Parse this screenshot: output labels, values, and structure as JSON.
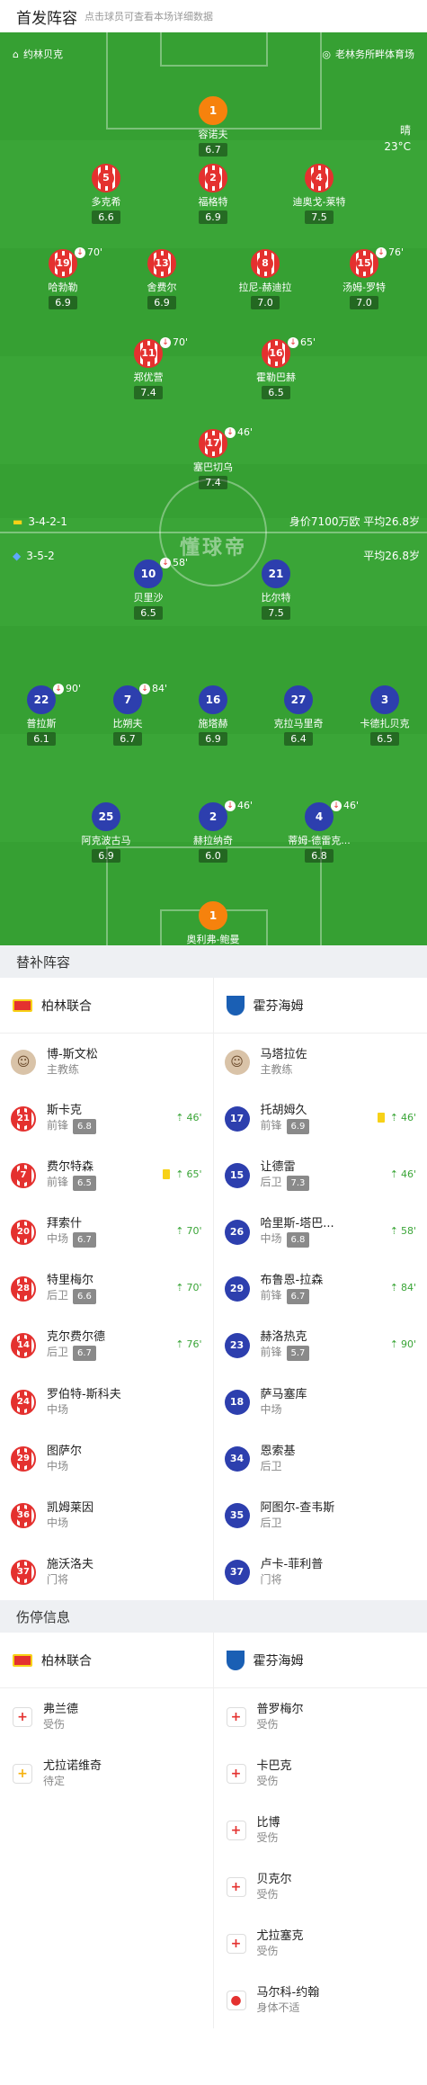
{
  "header": {
    "title": "首发阵容",
    "subtitle": "点击球员可查看本场详细数据"
  },
  "pitch": {
    "home_team": "约林贝克",
    "venue": "老林务所畔体育场",
    "weather": "晴",
    "temperature": "23°C",
    "watermark": "懂球帝",
    "home_formation": "3-4-2-1",
    "home_value": "身价7100万欧  平均26.8岁",
    "away_formation": "3-5-2",
    "away_value": "平均26.8岁"
  },
  "home_players": [
    {
      "num": "1",
      "name": "容诺夫",
      "rating": "6.7",
      "kit": "gk"
    },
    {
      "num": "5",
      "name": "多克希",
      "rating": "6.6",
      "kit": "red"
    },
    {
      "num": "2",
      "name": "福格特",
      "rating": "6.9",
      "kit": "red"
    },
    {
      "num": "4",
      "name": "迪奥戈-莱特",
      "rating": "7.5",
      "kit": "red"
    },
    {
      "num": "19",
      "name": "哈勃勒",
      "rating": "6.9",
      "kit": "red",
      "ev": "70'"
    },
    {
      "num": "13",
      "name": "舍费尔",
      "rating": "6.9",
      "kit": "red"
    },
    {
      "num": "8",
      "name": "拉尼-赫迪拉",
      "rating": "7.0",
      "kit": "red"
    },
    {
      "num": "15",
      "name": "汤姆-罗特",
      "rating": "7.0",
      "kit": "red",
      "ev": "76'"
    },
    {
      "num": "11",
      "name": "郑优营",
      "rating": "7.4",
      "kit": "red",
      "ev": "70'"
    },
    {
      "num": "16",
      "name": "霍勒巴赫",
      "rating": "6.5",
      "kit": "red",
      "ev": "65'"
    },
    {
      "num": "17",
      "name": "塞巴切乌",
      "rating": "7.4",
      "kit": "red",
      "ev": "46'"
    }
  ],
  "away_players": [
    {
      "num": "10",
      "name": "贝里沙",
      "rating": "6.5",
      "kit": "blue",
      "ev": "58'"
    },
    {
      "num": "21",
      "name": "比尔特",
      "rating": "7.5",
      "kit": "blue"
    },
    {
      "num": "22",
      "name": "普拉斯",
      "rating": "6.1",
      "kit": "blue",
      "ev": "90'"
    },
    {
      "num": "7",
      "name": "比朔夫",
      "rating": "6.7",
      "kit": "blue",
      "ev": "84'"
    },
    {
      "num": "16",
      "name": "施塔赫",
      "rating": "6.9",
      "kit": "blue"
    },
    {
      "num": "27",
      "name": "克拉马里奇",
      "rating": "6.4",
      "kit": "blue"
    },
    {
      "num": "3",
      "name": "卡德扎贝克",
      "rating": "6.5",
      "kit": "blue"
    },
    {
      "num": "25",
      "name": "阿克波古马",
      "rating": "6.9",
      "kit": "blue"
    },
    {
      "num": "2",
      "name": "赫拉纳奇",
      "rating": "6.0",
      "kit": "blue",
      "ev": "46'"
    },
    {
      "num": "4",
      "name": "蒂姆-德雷克...",
      "rating": "6.8",
      "kit": "blue",
      "ev": "46'"
    },
    {
      "num": "1",
      "name": "奥利弗-鲍曼",
      "rating": "6.4",
      "kit": "gk"
    }
  ],
  "subs": {
    "title": "替补阵容",
    "home_team": "柏林联合",
    "away_team": "霍芬海姆",
    "home": [
      {
        "num": "",
        "name": "博-斯文松",
        "pos": "主教练",
        "rating": "",
        "time": "",
        "coach": true
      },
      {
        "num": "21",
        "name": "斯卡克",
        "pos": "前锋",
        "rating": "6.8",
        "time": "46'"
      },
      {
        "num": "7",
        "name": "费尔特森",
        "pos": "前锋",
        "rating": "6.5",
        "time": "65'",
        "yellow": true
      },
      {
        "num": "20",
        "name": "拜索什",
        "pos": "中场",
        "rating": "6.7",
        "time": "70'"
      },
      {
        "num": "28",
        "name": "特里梅尔",
        "pos": "后卫",
        "rating": "6.6",
        "time": "70'"
      },
      {
        "num": "14",
        "name": "克尔费尔德",
        "pos": "后卫",
        "rating": "6.7",
        "time": "76'"
      },
      {
        "num": "24",
        "name": "罗伯特-斯科夫",
        "pos": "中场",
        "rating": "",
        "time": ""
      },
      {
        "num": "29",
        "name": "图萨尔",
        "pos": "中场",
        "rating": "",
        "time": ""
      },
      {
        "num": "36",
        "name": "凯姆莱因",
        "pos": "中场",
        "rating": "",
        "time": ""
      },
      {
        "num": "37",
        "name": "施沃洛夫",
        "pos": "门将",
        "rating": "",
        "time": ""
      }
    ],
    "away": [
      {
        "num": "",
        "name": "马塔拉佐",
        "pos": "主教练",
        "rating": "",
        "time": "",
        "coach": true
      },
      {
        "num": "17",
        "name": "托胡姆久",
        "pos": "前锋",
        "rating": "6.9",
        "time": "46'",
        "yellow": true
      },
      {
        "num": "15",
        "name": "让德雷",
        "pos": "后卫",
        "rating": "7.3",
        "time": "46'"
      },
      {
        "num": "26",
        "name": "哈里斯-塔巴...",
        "pos": "中场",
        "rating": "6.8",
        "time": "58'"
      },
      {
        "num": "29",
        "name": "布鲁恩-拉森",
        "pos": "前锋",
        "rating": "6.7",
        "time": "84'"
      },
      {
        "num": "23",
        "name": "赫洛热克",
        "pos": "前锋",
        "rating": "5.7",
        "time": "90'"
      },
      {
        "num": "18",
        "name": "萨马塞库",
        "pos": "中场",
        "rating": "",
        "time": ""
      },
      {
        "num": "34",
        "name": "恩索基",
        "pos": "后卫",
        "rating": "",
        "time": ""
      },
      {
        "num": "35",
        "name": "阿图尔-查韦斯",
        "pos": "后卫",
        "rating": "",
        "time": ""
      },
      {
        "num": "37",
        "name": "卢卡-菲利普",
        "pos": "门将",
        "rating": "",
        "time": ""
      }
    ]
  },
  "injuries": {
    "title": "伤停信息",
    "home_team": "柏林联合",
    "away_team": "霍芬海姆",
    "home": [
      {
        "name": "弗兰德",
        "status": "受伤",
        "type": "injury"
      },
      {
        "name": "尤拉诺维奇",
        "status": "待定",
        "type": "doubt"
      }
    ],
    "away": [
      {
        "name": "普罗梅尔",
        "status": "受伤",
        "type": "injury"
      },
      {
        "name": "卡巴克",
        "status": "受伤",
        "type": "injury"
      },
      {
        "name": "比博",
        "status": "受伤",
        "type": "injury"
      },
      {
        "name": "贝克尔",
        "status": "受伤",
        "type": "injury"
      },
      {
        "name": "尤拉塞克",
        "status": "受伤",
        "type": "injury"
      },
      {
        "name": "马尔科-约翰",
        "status": "身体不适",
        "type": "ill"
      }
    ]
  }
}
